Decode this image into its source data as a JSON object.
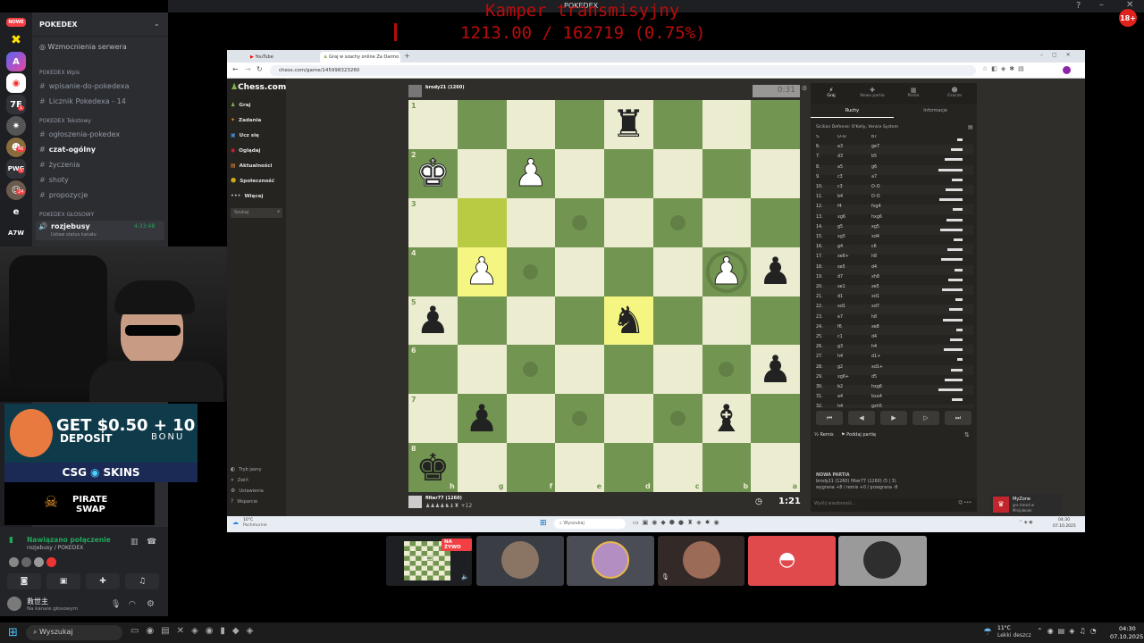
{
  "overlay": {
    "title": "Kamper transmisyjny",
    "progress_text": "1213.00 / 162719 (0.75%)",
    "progress": 0.0075,
    "color": "#b90c0c"
  },
  "topbar": {
    "title": "POKEDEX",
    "age_badge": "18+"
  },
  "rail": {
    "new_badge": "NOWE",
    "badges": [
      "1",
      "46",
      "5",
      "24"
    ],
    "labels": [
      "7F",
      "PWG",
      "e",
      "A7W"
    ]
  },
  "discord": {
    "server": "POKEDEX",
    "boost": "Wzmocnienia serwera",
    "cat1": "POKEDEX Wpis",
    "ch1": [
      "wpisanie-do-pokedexa",
      "Licznik Pokedexa - 14"
    ],
    "cat2": "POKEDEX Tekstowy",
    "ch2": [
      "ogłoszenia-pokedex",
      "czat-ogólny",
      "życzenia",
      "shoty",
      "propozycje"
    ],
    "cat3": "POKEDEX GŁOSOWY",
    "voice_ch": "rozjebusy",
    "voice_time": "4:33:48",
    "voice_status": "Ustaw status kanału",
    "conn_status": "Nawiązano połączenie",
    "conn_sub": "rozjebusy / POKEDEX",
    "user": "救世主",
    "user_sub": "Na kanale głosowym"
  },
  "ads": {
    "csg1": "GET $0.50 + 10",
    "csg2": "DEPOSIT",
    "csg3": "BONU",
    "csg_brand": "CSG",
    "csg_brand2": "SKINS",
    "pirate1": "PIRATE",
    "pirate2": "SWAP"
  },
  "browser": {
    "tab1": "YouTube",
    "tab2": "Graj w szachy online Za Darmo",
    "url": "chess.com/game/145998323260"
  },
  "chess": {
    "logo": "Chess.com",
    "nav": [
      "Graj",
      "Zadania",
      "Ucz się",
      "Oglądaj",
      "Aktualności",
      "Społeczność",
      "Więcej"
    ],
    "search": "Szukaj",
    "bottom_nav": [
      "Tryb jasny",
      "Zwiń",
      "Ustawienia",
      "Wsparcie"
    ],
    "opponent": "brody21 (1260)",
    "opp_clock": "0:31",
    "player": "filter77 (1260)",
    "player_clock": "1:21",
    "material": "+12",
    "ranks": [
      "1",
      "2",
      "3",
      "4",
      "5",
      "6",
      "7",
      "8"
    ],
    "files": [
      "h",
      "g",
      "f",
      "e",
      "d",
      "c",
      "b",
      "a"
    ]
  },
  "panel": {
    "tabs": [
      "Graj",
      "Nowa partia",
      "Partie",
      "Gracze"
    ],
    "subtabs": [
      "Ruchy",
      "Informacje"
    ],
    "opening": "Sicilian Defense: O'Kelly, Venice System",
    "moves": [
      [
        "5.",
        "O-O",
        "b7"
      ],
      [
        "6.",
        "a3",
        "ge7"
      ],
      [
        "7.",
        "d3",
        "b5"
      ],
      [
        "8.",
        "a5",
        "g6"
      ],
      [
        "9.",
        "c3",
        "a7"
      ],
      [
        "10.",
        "c3",
        "O-O"
      ],
      [
        "11.",
        "b4",
        "O-O"
      ],
      [
        "12.",
        "f4",
        "fxg4"
      ],
      [
        "13.",
        "xg6",
        "hxg6"
      ],
      [
        "14.",
        "g5",
        "xg5"
      ],
      [
        "15.",
        "xg5",
        "xd4"
      ],
      [
        "16.",
        "g4",
        "c6"
      ],
      [
        "17.",
        "xe6+",
        "h8"
      ],
      [
        "18.",
        "xe5",
        "d4"
      ],
      [
        "19.",
        "d7",
        "xh8"
      ],
      [
        "20.",
        "xe1",
        "xe5"
      ],
      [
        "21.",
        "d1",
        "xd1"
      ],
      [
        "22.",
        "xd1",
        "xd7"
      ],
      [
        "23.",
        "e7",
        "h8"
      ],
      [
        "24.",
        "f6",
        "xe8"
      ],
      [
        "25.",
        "c1",
        "d4"
      ],
      [
        "26.",
        "g3",
        "h4"
      ],
      [
        "27.",
        "h4",
        "d1+"
      ],
      [
        "28.",
        "g2",
        "xd1+"
      ],
      [
        "29.",
        "xg6+",
        "d5"
      ],
      [
        "30.",
        "b2",
        "hxg6"
      ],
      [
        "31.",
        "a4",
        "bxa4"
      ],
      [
        "32.",
        "h4",
        "gxh5"
      ],
      [
        "33.",
        "g4",
        ""
      ]
    ],
    "draw": "Remis",
    "resign": "Poddaj partię",
    "new_game_title": "NOWA PARTIA",
    "new_game_line": "brody21 (1260) filter77 (1260) (5 | 3)",
    "new_game_odds": "wygrana +8 / remis +0 / przegrana -8",
    "chat_placeholder": "Wyślij wiadomość..."
  },
  "win_inner": {
    "weather_temp": "10°C",
    "weather_desc": "Pochmurnie",
    "search": "Wyszukaj",
    "time": "04:30",
    "date": "07.10.2025"
  },
  "notif": {
    "title": "MyZone",
    "line": "gra timed w",
    "line2": "Minijaboek"
  },
  "thumbs": {
    "live": "NA ŻYWO"
  },
  "taskbar": {
    "search": "Wyszukaj",
    "weather_temp": "11°C",
    "weather_desc": "Lekki deszcz",
    "time": "04:30",
    "date": "07.10.2025"
  }
}
